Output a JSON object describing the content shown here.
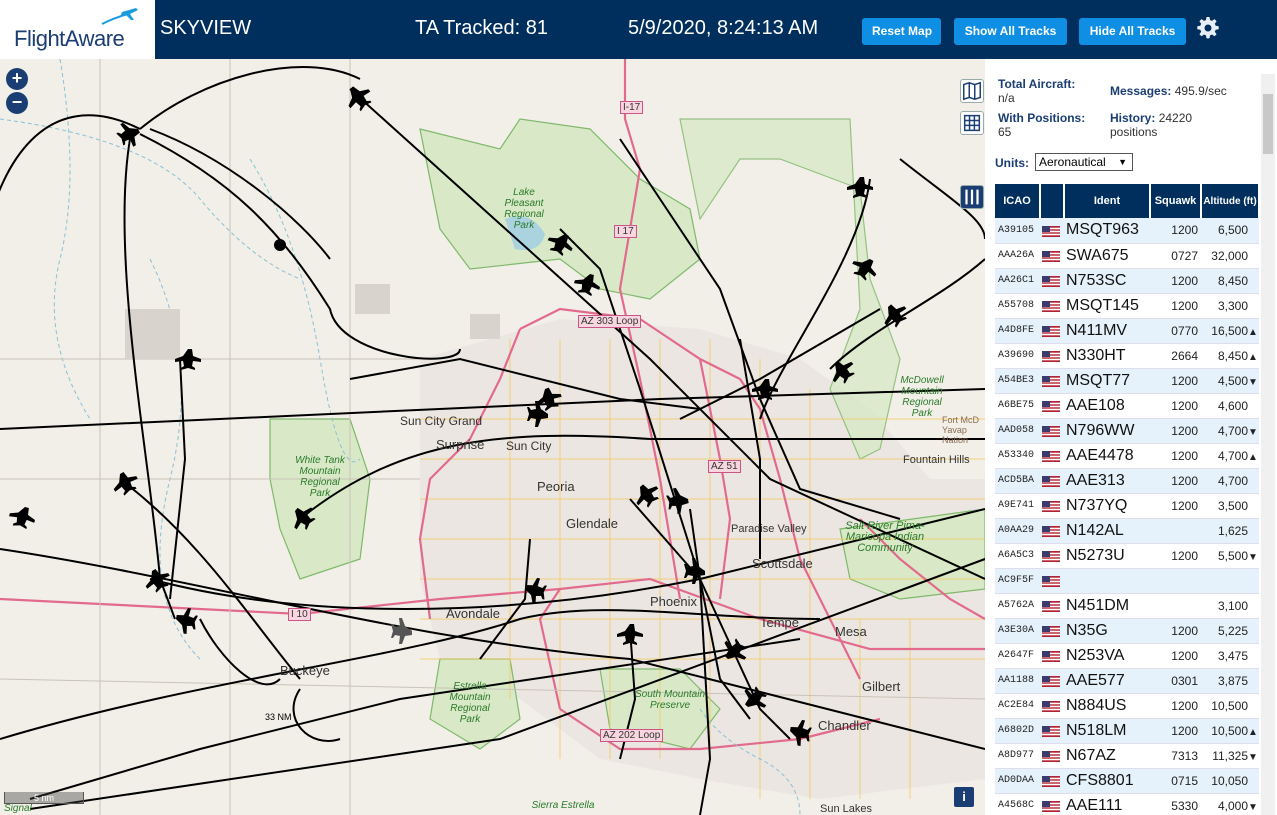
{
  "header": {
    "logo_text": "FlightAware",
    "app_title": "SKYVIEW",
    "tracked": "TA Tracked: 81",
    "clock": "5/9/2020, 8:24:13 AM",
    "btn_reset": "Reset Map",
    "btn_show": "Show All Tracks",
    "btn_hide": "Hide All Tracks",
    "settings_icon": "gear-icon"
  },
  "colors": {
    "header_bg": "#002f5d",
    "button_bg": "#0f8fe3",
    "table_header_bg": "#002f5d",
    "row_alt_bg": "#e5f2fb",
    "highway": "#e26a8d",
    "park": "#7fb86b"
  },
  "map": {
    "zoom_in": "+",
    "zoom_out": "−",
    "scale": "5 nm",
    "range_ring": "33 NM",
    "info": "i",
    "labels": {
      "sun_city_grand": "Sun City Grand",
      "surprise": "Surprise",
      "sun_city": "Sun City",
      "peoria": "Peoria",
      "glendale": "Glendale",
      "avondale": "Avondale",
      "phoenix": "Phoenix",
      "tempe": "Tempe",
      "mesa": "Mesa",
      "scottsdale": "Scottsdale",
      "paradise_valley": "Paradise Valley",
      "fountain_hills": "Fountain Hills",
      "gilbert": "Gilbert",
      "chandler": "Chandler",
      "buckeye": "Buckeye",
      "sun_lakes": "Sun Lakes",
      "i17": "I-17",
      "i17b": "I 17",
      "i10": "I 10",
      "az303": "AZ 303 Loop",
      "az51": "AZ 51",
      "az202": "AZ 202 Loop",
      "lake_pleasant": "Lake Pleasant Regional Park",
      "white_tank": "White Tank Mountain Regional Park",
      "estrella": "Estrella Mountain Regional Park",
      "south_mountain": "South Mountain Preserve",
      "mcdowell": "McDowell Mountain Regional Park",
      "salt_river": "Salt River Pima-Maricopa Indian Community",
      "fort_mcdowell": "Fort McD Yavap Nation",
      "sierra_estrella": "Sierra Estrella",
      "signal": "Signal"
    }
  },
  "stats": {
    "total_label": "Total Aircraft:",
    "total_value": "n/a",
    "positions_label": "With Positions:",
    "positions_value": "65",
    "messages_label": "Messages:",
    "messages_value": "495.9/sec",
    "history_label": "History:",
    "history_value": "24220",
    "history_unit": "positions"
  },
  "units": {
    "label": "Units:",
    "selected": "Aeronautical"
  },
  "table": {
    "headers": {
      "icao": "ICAO",
      "ident": "Ident",
      "squawk": "Squawk",
      "altitude": "Altitude (ft)"
    },
    "rows": [
      {
        "icao": "A39105",
        "ident": "MSQT963",
        "squawk": "1200",
        "alt": "6,500",
        "trend": ""
      },
      {
        "icao": "AAA26A",
        "ident": "SWA675",
        "squawk": "0727",
        "alt": "32,000",
        "trend": ""
      },
      {
        "icao": "AA26C1",
        "ident": "N753SC",
        "squawk": "1200",
        "alt": "8,450",
        "trend": ""
      },
      {
        "icao": "A55708",
        "ident": "MSQT145",
        "squawk": "1200",
        "alt": "3,300",
        "trend": ""
      },
      {
        "icao": "A4D8FE",
        "ident": "N411MV",
        "squawk": "0770",
        "alt": "16,500",
        "trend": "▲"
      },
      {
        "icao": "A39690",
        "ident": "N330HT",
        "squawk": "2664",
        "alt": "8,450",
        "trend": "▲"
      },
      {
        "icao": "A54BE3",
        "ident": "MSQT77",
        "squawk": "1200",
        "alt": "4,500",
        "trend": "▼"
      },
      {
        "icao": "A6BE75",
        "ident": "AAE108",
        "squawk": "1200",
        "alt": "4,600",
        "trend": ""
      },
      {
        "icao": "AAD058",
        "ident": "N796WW",
        "squawk": "1200",
        "alt": "4,700",
        "trend": "▼"
      },
      {
        "icao": "A53340",
        "ident": "AAE4478",
        "squawk": "1200",
        "alt": "4,700",
        "trend": "▲"
      },
      {
        "icao": "ACD5BA",
        "ident": "AAE313",
        "squawk": "1200",
        "alt": "4,700",
        "trend": ""
      },
      {
        "icao": "A9E741",
        "ident": "N737YQ",
        "squawk": "1200",
        "alt": "3,500",
        "trend": ""
      },
      {
        "icao": "A0AA29",
        "ident": "N142AL",
        "squawk": "",
        "alt": "1,625",
        "trend": ""
      },
      {
        "icao": "A6A5C3",
        "ident": "N5273U",
        "squawk": "1200",
        "alt": "5,500",
        "trend": "▼"
      },
      {
        "icao": "AC9F5F",
        "ident": "",
        "squawk": "",
        "alt": "",
        "trend": ""
      },
      {
        "icao": "A5762A",
        "ident": "N451DM",
        "squawk": "",
        "alt": "3,100",
        "trend": ""
      },
      {
        "icao": "A3E30A",
        "ident": "N35G",
        "squawk": "1200",
        "alt": "5,225",
        "trend": ""
      },
      {
        "icao": "A2647F",
        "ident": "N253VA",
        "squawk": "1200",
        "alt": "3,475",
        "trend": ""
      },
      {
        "icao": "AA1188",
        "ident": "AAE577",
        "squawk": "0301",
        "alt": "3,875",
        "trend": ""
      },
      {
        "icao": "AC2E84",
        "ident": "N884US",
        "squawk": "1200",
        "alt": "10,500",
        "trend": ""
      },
      {
        "icao": "A6802D",
        "ident": "N518LM",
        "squawk": "1200",
        "alt": "10,500",
        "trend": "▲"
      },
      {
        "icao": "A8D977",
        "ident": "N67AZ",
        "squawk": "7313",
        "alt": "11,325",
        "trend": "▼"
      },
      {
        "icao": "AD0DAA",
        "ident": "CFS8801",
        "squawk": "0715",
        "alt": "10,050",
        "trend": ""
      },
      {
        "icao": "A4568C",
        "ident": "AAE111",
        "squawk": "5330",
        "alt": "4,000",
        "trend": "▼"
      }
    ]
  }
}
